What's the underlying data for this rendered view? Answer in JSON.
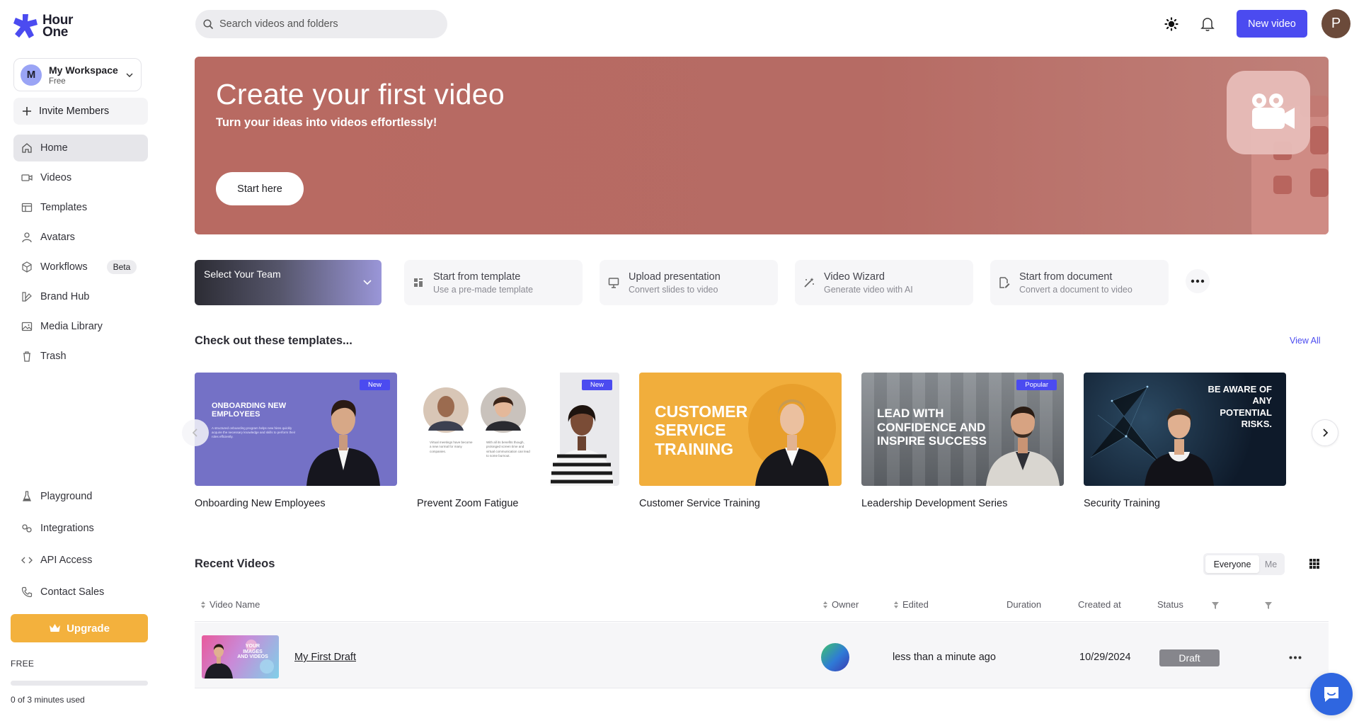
{
  "app": {
    "logo_line1": "Hour",
    "logo_line2": "One"
  },
  "workspace": {
    "initial": "M",
    "name": "My Workspace",
    "plan": "Free"
  },
  "sidebar": {
    "invite_label": "Invite Members",
    "items": [
      {
        "label": "Home",
        "icon": "home-icon",
        "active": true
      },
      {
        "label": "Videos",
        "icon": "video-icon"
      },
      {
        "label": "Templates",
        "icon": "templates-icon"
      },
      {
        "label": "Avatars",
        "icon": "user-icon"
      },
      {
        "label": "Workflows",
        "icon": "cube-icon",
        "badge": "Beta"
      },
      {
        "label": "Brand Hub",
        "icon": "brand-icon"
      },
      {
        "label": "Media Library",
        "icon": "image-icon"
      },
      {
        "label": "Trash",
        "icon": "trash-icon"
      }
    ],
    "bottom_items": [
      {
        "label": "Playground",
        "icon": "flask-icon"
      },
      {
        "label": "Integrations",
        "icon": "integrations-icon"
      },
      {
        "label": "API Access",
        "icon": "code-icon"
      },
      {
        "label": "Contact Sales",
        "icon": "phone-icon"
      }
    ],
    "upgrade_label": "Upgrade",
    "plan_label": "FREE",
    "usage_text": "0 of 3 minutes used",
    "usage_fraction": 0
  },
  "header": {
    "search_placeholder": "Search videos and folders",
    "new_video_label": "New video",
    "user_initial": "P"
  },
  "hero": {
    "title": "Create your first video",
    "subtitle": "Turn your ideas into videos effortlessly!",
    "button_label": "Start here"
  },
  "team_select": {
    "label": "Select Your Team"
  },
  "actions": [
    {
      "title": "Start from template",
      "subtitle": "Use a pre-made template",
      "icon": "template-icon"
    },
    {
      "title": "Upload presentation",
      "subtitle": "Convert slides to video",
      "icon": "presentation-icon"
    },
    {
      "title": "Video Wizard",
      "subtitle": "Generate video with AI",
      "icon": "magic-wand-icon"
    },
    {
      "title": "Start from document",
      "subtitle": "Convert a document to video",
      "icon": "document-icon"
    }
  ],
  "templates_section": {
    "title": "Check out these templates...",
    "view_all": "View All",
    "items": [
      {
        "name": "Onboarding New Employees",
        "badge": "New",
        "thumb_text": "Onboarding new employees",
        "thumb_caption": "A structured onboarding program helps new hires quickly acquire the necessary knowledge and skills to perform their roles efficiently."
      },
      {
        "name": "Prevent Zoom Fatigue",
        "badge": "New",
        "thumb_caption_1": "Virtual meetings have become a new normal for many companies.",
        "thumb_caption_2": "With all its benefits though, prolonged screen time and virtual communication can lead to some burnout."
      },
      {
        "name": "Customer Service Training",
        "thumb_text": "Customer service training"
      },
      {
        "name": "Leadership Development Series",
        "badge": "Popular",
        "thumb_text": "Lead with confidence and inspire success"
      },
      {
        "name": "Security Training",
        "thumb_text": "Be aware of any potential risks."
      }
    ]
  },
  "recent": {
    "title": "Recent Videos",
    "filter_on": "Everyone",
    "filter_off": "Me",
    "columns": {
      "name": "Video Name",
      "owner": "Owner",
      "edited": "Edited",
      "duration": "Duration",
      "created": "Created at",
      "status": "Status"
    },
    "rows": [
      {
        "name": "My First Draft",
        "thumb_text": "Your images and videos",
        "edited": "less than a minute ago",
        "created": "10/29/2024",
        "status": "Draft"
      }
    ]
  },
  "colors": {
    "accent": "#4b4bf0",
    "upgrade": "#f3b13d",
    "hero": "#b86a62"
  }
}
